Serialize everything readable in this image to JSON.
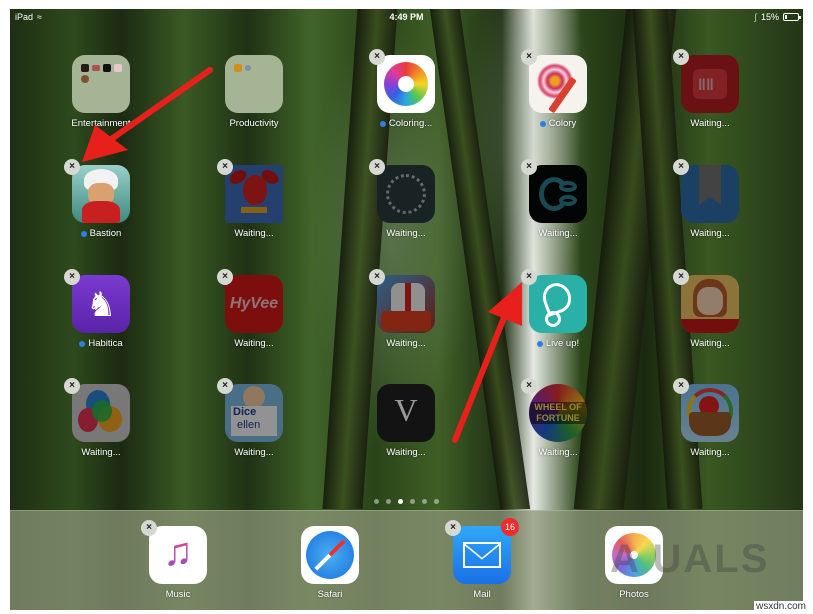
{
  "status_bar": {
    "device": "iPad",
    "time": "4:49 PM",
    "battery_percent": "15%",
    "battery_level": 0.15
  },
  "apps": [
    {
      "label": "Entertainment",
      "type": "folder",
      "new": false,
      "deletable": false,
      "dimmed": false
    },
    {
      "label": "Productivity",
      "type": "folder",
      "new": false,
      "deletable": false,
      "dimmed": false
    },
    {
      "label": "Coloring...",
      "type": "app",
      "new": true,
      "deletable": true,
      "dimmed": false,
      "icon": "mandala-color-wheel-icon"
    },
    {
      "label": "Colory",
      "type": "app",
      "new": true,
      "deletable": true,
      "dimmed": false,
      "icon": "mandala-pencil-icon"
    },
    {
      "label": "Waiting...",
      "type": "app",
      "new": false,
      "deletable": true,
      "dimmed": true,
      "icon": "red-stripes-app-icon"
    },
    {
      "label": "Bastion",
      "type": "app",
      "new": true,
      "deletable": true,
      "dimmed": false,
      "icon": "bastion-character-icon"
    },
    {
      "label": "Waiting...",
      "type": "app",
      "new": false,
      "deletable": true,
      "dimmed": true,
      "icon": "red-bird-icon"
    },
    {
      "label": "Waiting...",
      "type": "app",
      "new": false,
      "deletable": true,
      "dimmed": true,
      "icon": "loading-circle-icon"
    },
    {
      "label": "Waiting...",
      "type": "app",
      "new": false,
      "deletable": true,
      "dimmed": true,
      "icon": "loop-logo-icon"
    },
    {
      "label": "Waiting...",
      "type": "app",
      "new": false,
      "deletable": true,
      "dimmed": true,
      "icon": "bookmark-icon"
    },
    {
      "label": "Habitica",
      "type": "app",
      "new": true,
      "deletable": true,
      "dimmed": false,
      "icon": "griffin-icon"
    },
    {
      "label": "Waiting...",
      "type": "app",
      "new": false,
      "deletable": true,
      "dimmed": true,
      "icon": "hyvee-logo-icon"
    },
    {
      "label": "Waiting...",
      "type": "app",
      "new": false,
      "deletable": true,
      "dimmed": true,
      "icon": "football-game-icon"
    },
    {
      "label": "Live up!",
      "type": "app",
      "new": true,
      "deletable": true,
      "dimmed": false,
      "icon": "leaf-icon"
    },
    {
      "label": "Waiting...",
      "type": "app",
      "new": false,
      "deletable": true,
      "dimmed": true,
      "icon": "mii-avatar-icon"
    },
    {
      "label": "Waiting...",
      "type": "app",
      "new": false,
      "deletable": true,
      "dimmed": true,
      "icon": "balloons-icon"
    },
    {
      "label": "Waiting...",
      "type": "app",
      "new": false,
      "deletable": true,
      "dimmed": true,
      "icon": "dice-ellen-icon"
    },
    {
      "label": "Waiting...",
      "type": "app",
      "new": false,
      "deletable": false,
      "dimmed": true,
      "icon": "letter-v-icon"
    },
    {
      "label": "Waiting...",
      "type": "app",
      "new": false,
      "deletable": true,
      "dimmed": true,
      "icon": "wheel-of-fortune-icon"
    },
    {
      "label": "Waiting...",
      "type": "app",
      "new": false,
      "deletable": true,
      "dimmed": true,
      "icon": "fruit-basket-icon"
    }
  ],
  "icon_texts": {
    "hyvee": "HyVee",
    "v": "V",
    "dice": "Dice",
    "ellen": "ellen",
    "wof1": "WHEEL OF",
    "wof2": "FORTUNE"
  },
  "page_indicator": {
    "count": 6,
    "active": 2
  },
  "dock": [
    {
      "label": "Music",
      "deletable": true,
      "badge": null
    },
    {
      "label": "Safari",
      "deletable": false,
      "badge": null
    },
    {
      "label": "Mail",
      "deletable": true,
      "badge": "16"
    },
    {
      "label": "Photos",
      "deletable": false,
      "badge": null
    }
  ],
  "watermark": {
    "logo": "A  UALS",
    "site": "wsxdn.com"
  },
  "colors": {
    "annotation_arrow": "#e8201c",
    "new_dot": "#2f7fe0",
    "badge": "#ef2b2b"
  }
}
